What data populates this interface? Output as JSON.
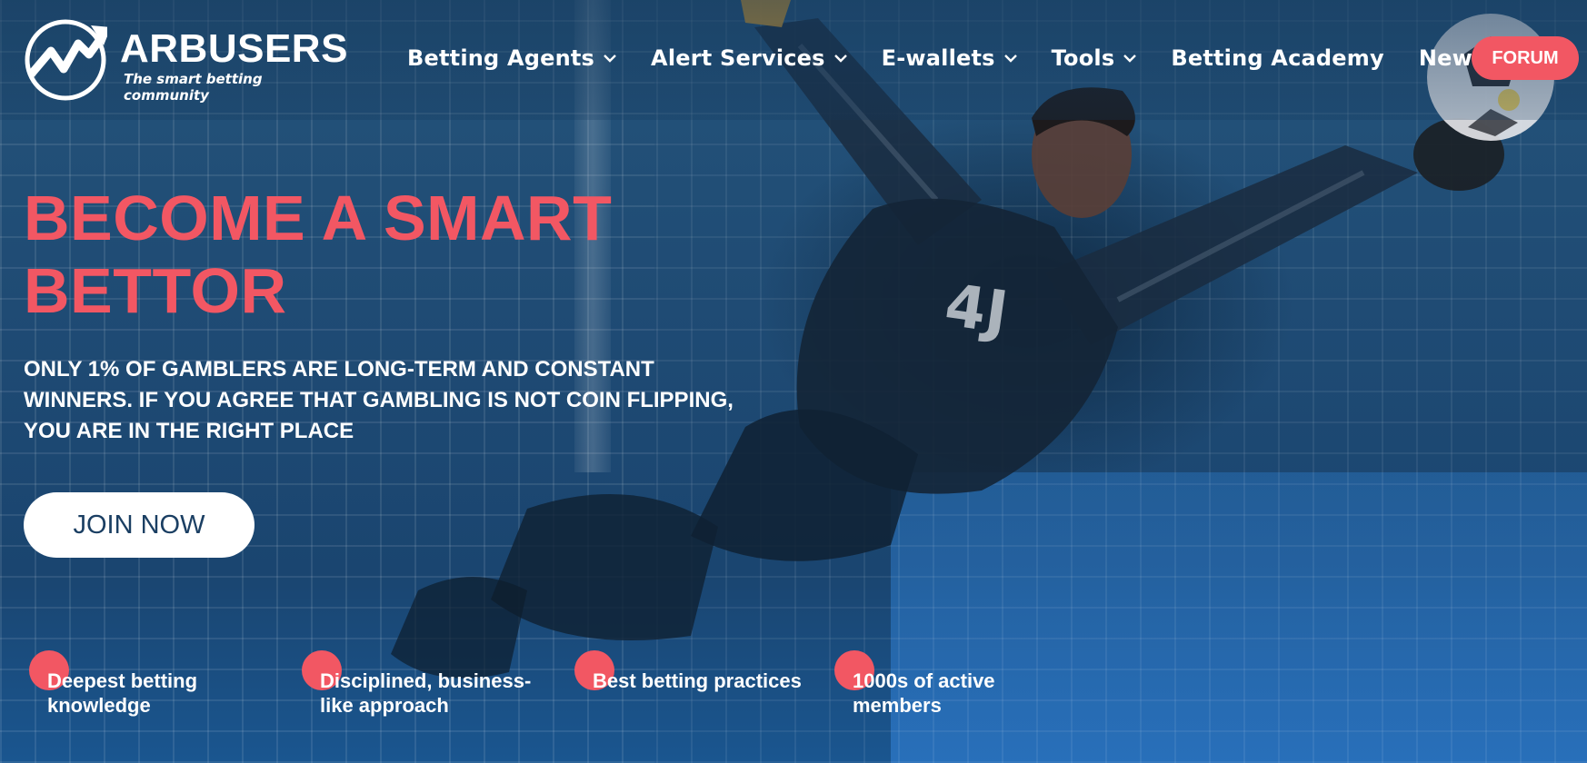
{
  "logo": {
    "title": "ARBUSERS",
    "tagline": "The smart betting community"
  },
  "nav": {
    "items": [
      {
        "label": "Betting Agents",
        "has_dropdown": true
      },
      {
        "label": "Alert Services",
        "has_dropdown": true
      },
      {
        "label": "E-wallets",
        "has_dropdown": true
      },
      {
        "label": "Tools",
        "has_dropdown": true
      },
      {
        "label": "Betting Academy",
        "has_dropdown": false
      },
      {
        "label": "News",
        "has_dropdown": false
      }
    ],
    "forum_label": "FORUM"
  },
  "hero": {
    "headline_line1": "BECOME A SMART",
    "headline_line2": "BETTOR",
    "sub_line1": "ONLY 1% OF GAMBLERS ARE LONG-TERM AND CONSTANT",
    "sub_line2": "WINNERS. IF YOU AGREE THAT GAMBLING IS NOT COIN FLIPPING,",
    "sub_line3": "YOU ARE IN THE RIGHT PLACE",
    "cta_label": "JOIN NOW"
  },
  "features": [
    {
      "line1": "Deepest betting",
      "line2": "knowledge"
    },
    {
      "line1": "Disciplined, business-",
      "line2": "like approach"
    },
    {
      "line1": "Best betting practices",
      "line2": ""
    },
    {
      "line1": "1000s of active",
      "line2": "members"
    }
  ],
  "colors": {
    "accent": "#f25763",
    "overlay": "#1b3f63",
    "text": "#ffffff"
  },
  "icons": [
    "logo-mark-icon",
    "chevron-down-icon"
  ]
}
